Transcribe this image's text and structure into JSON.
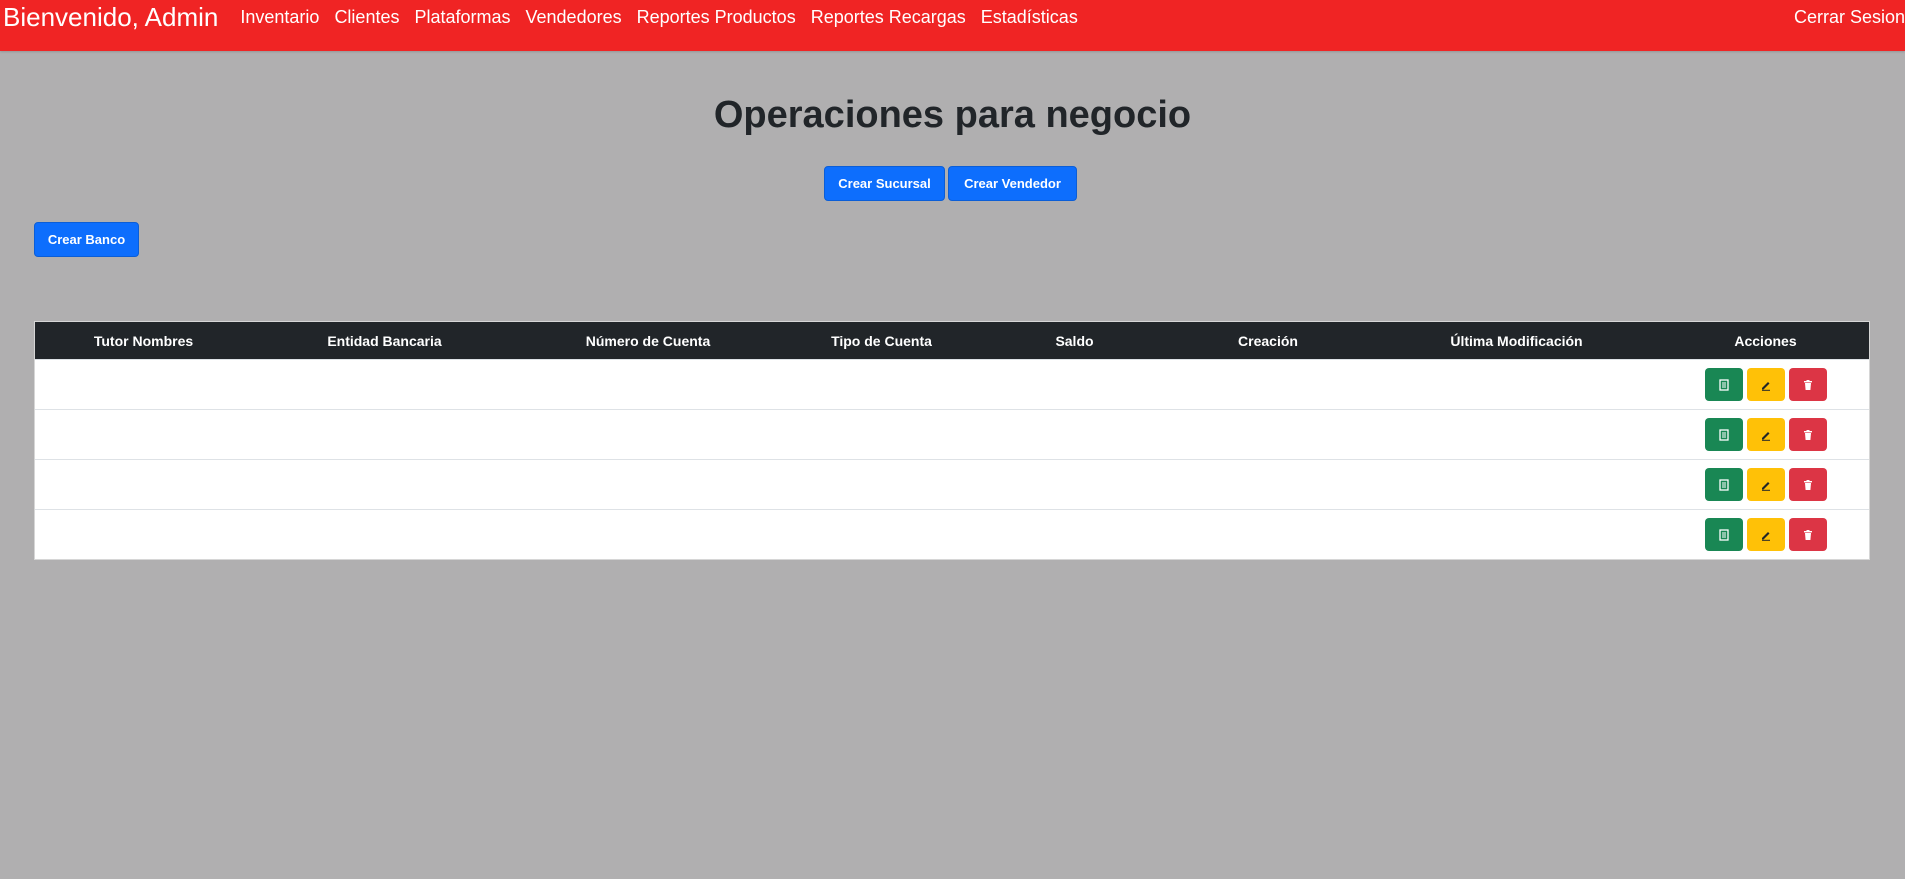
{
  "navbar": {
    "brand": "Bienvenido, Admin",
    "links": [
      "Inventario",
      "Clientes",
      "Plataformas",
      "Vendedores",
      "Reportes Productos",
      "Reportes Recargas",
      "Estadísticas"
    ],
    "logout": "Cerrar Sesion"
  },
  "page": {
    "title": "Operaciones para negocio",
    "btn_sucursal": "Crear Sucursal",
    "btn_vendedor": "Crear Vendedor",
    "btn_banco": "Crear Banco"
  },
  "table": {
    "headers": [
      "Tutor Nombres",
      "Entidad Bancaria",
      "Número de Cuenta",
      "Tipo de Cuenta",
      "Saldo",
      "Creación",
      "Última Modificación",
      "Acciones"
    ],
    "rows": [
      [
        "",
        "",
        "",
        "",
        "",
        "",
        ""
      ],
      [
        "",
        "",
        "",
        "",
        "",
        "",
        ""
      ],
      [
        "",
        "",
        "",
        "",
        "",
        "",
        ""
      ],
      [
        "",
        "",
        "",
        "",
        "",
        "",
        ""
      ]
    ],
    "action_icons": [
      "document-icon",
      "pencil-icon",
      "trash-icon"
    ]
  },
  "colors": {
    "navbar": "#f02424",
    "background": "#b0afb0",
    "primary": "#0d6efd",
    "success": "#198754",
    "warning": "#ffc107",
    "danger": "#dc3545",
    "table_header": "#212529"
  }
}
